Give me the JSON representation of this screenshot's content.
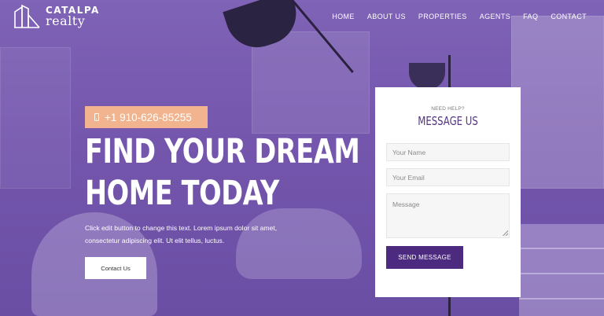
{
  "logo": {
    "line1": "CATALPA",
    "line2": "realty",
    "icon": "building-logo-icon"
  },
  "nav": {
    "items": [
      {
        "label": "HOME",
        "active": true
      },
      {
        "label": "ABOUT US",
        "active": false
      },
      {
        "label": "PROPERTIES",
        "active": false
      },
      {
        "label": "AGENTS",
        "active": false
      },
      {
        "label": "FAQ",
        "active": false
      },
      {
        "label": "CONTACT",
        "active": false
      }
    ]
  },
  "hero": {
    "phone_icon": "mobile-phone-icon",
    "phone": "+1 910-626-85255",
    "headline_line1": "FIND YOUR DREAM",
    "headline_line2": "HOME TODAY",
    "subtext": "Click edit button to change this text. Lorem ipsum dolor sit amet, consectetur adipiscing elit. Ut elit tellus, luctus.",
    "contact_button": "Contact Us"
  },
  "form": {
    "kicker": "NEED HELP?",
    "title": "MESSAGE US",
    "name_placeholder": "Your Name",
    "email_placeholder": "Your Email",
    "message_placeholder": "Message",
    "send_button": "SEND MESSAGE"
  },
  "colors": {
    "overlay_purple": "#7456ad",
    "badge_peach": "#f1b48e",
    "brand_purple": "#4c2a80",
    "title_purple": "#52337e"
  }
}
